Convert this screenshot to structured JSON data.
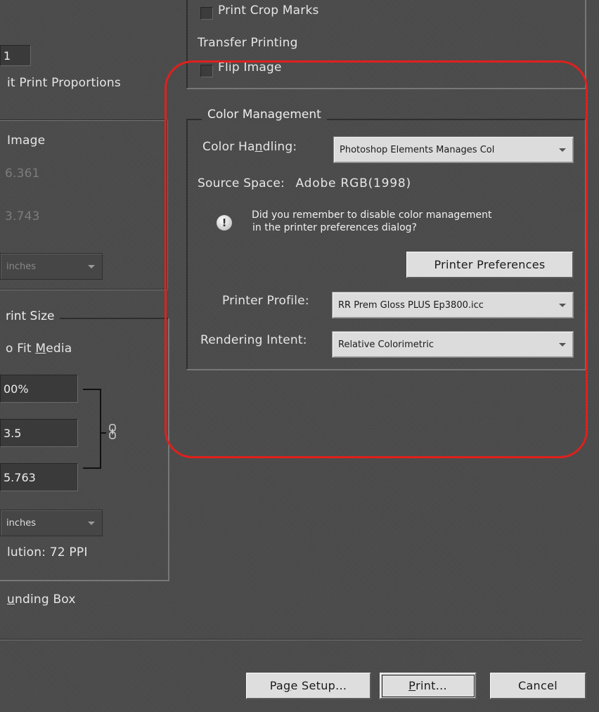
{
  "output_options": {
    "print_crop_marks_label": "Print Crop Marks",
    "transfer_printing_label": "Transfer Printing",
    "flip_image_label": "Flip Image"
  },
  "left_panel": {
    "page_number_value": "1",
    "print_proportions_label": "it Print Proportions",
    "image_section_label": "Image",
    "image_width": "6.361",
    "image_height": "3.743",
    "image_units": "inches",
    "print_size_legend": "rint Size",
    "fit_media_pre": "o Fit ",
    "fit_media_accel": "M",
    "fit_media_post": "edia",
    "scale_value": "00%",
    "height_value": "3.5",
    "width_value": "5.763",
    "print_units": "inches",
    "resolution_text": "lution: 72 PPI",
    "bounding_box_accel": "u",
    "bounding_box_post": "nding Box"
  },
  "color_management": {
    "legend": "Color Management",
    "handling_pre": "Color Ha",
    "handling_accel": "n",
    "handling_post": "dling:",
    "handling_value": "Photoshop Elements Manages Col",
    "source_space_label": "Source Space:",
    "source_space_value": "Adobe RGB(1998)",
    "notice_line1": "Did you remember to disable color management",
    "notice_line2": "in the printer preferences dialog?",
    "printer_preferences_button": "Printer Preferences",
    "printer_profile_label": "Printer Profile:",
    "printer_profile_value": "RR Prem Gloss PLUS Ep3800.icc",
    "rendering_intent_label": "Rendering Intent:",
    "rendering_intent_value": "Relative Colorimetric",
    "highlight_color": "#e0201c"
  },
  "footer": {
    "page_setup_pre": "Pa",
    "page_setup_accel": "g",
    "page_setup_post": "e Setup...",
    "print_accel": "P",
    "print_post": "rint...",
    "cancel_label": "Cancel"
  }
}
